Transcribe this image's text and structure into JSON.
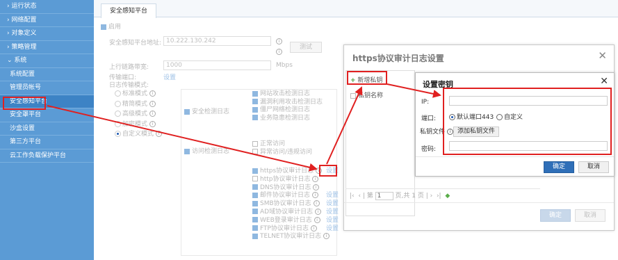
{
  "sidebar": {
    "items": [
      {
        "label": "› 运行状态"
      },
      {
        "label": "› 网络配置"
      },
      {
        "label": "› 对象定义"
      },
      {
        "label": "› 策略管理"
      },
      {
        "label": "⌄ 系统"
      },
      {
        "label": "系统配置"
      },
      {
        "label": "管理员帐号"
      },
      {
        "label": "安全感知平台"
      },
      {
        "label": "安全罩平台"
      },
      {
        "label": "沙盒设置"
      },
      {
        "label": "第三方平台"
      },
      {
        "label": "云工作负载保护平台"
      }
    ]
  },
  "tab": {
    "label": "安全感知平台"
  },
  "bg_form": {
    "enable_label": "启用",
    "address_label": "安全感知平台地址:",
    "address_value": "10.222.130.242",
    "test_button": "测试",
    "bandwidth_label": "上行链路带宽:",
    "bandwidth_value": "1000",
    "bandwidth_unit": "Mbps",
    "port_label": "传输端口:",
    "port_link": "设置",
    "mode_label": "日志传输模式:",
    "modes": [
      "标准模式",
      "精简模式",
      "高级模式",
      "加密模式",
      "自定义模式"
    ],
    "security_log": "安全检测日志",
    "access_log": "访问检测日志",
    "security_sub": [
      "网站攻击检测日志",
      "漏洞利用攻击检测日志",
      "僵尸网络检测日志",
      "业务隐患检测日志"
    ],
    "access_sub": [
      "正常访问",
      "异常访问/违规访问"
    ],
    "audit_list": [
      {
        "label": "https协议审计日志",
        "on": true,
        "link": "设置"
      },
      {
        "label": "http协议审计日志",
        "on": false,
        "link": ""
      },
      {
        "label": "DNS协议审计日志",
        "on": true,
        "link": ""
      },
      {
        "label": "邮件协议审计日志",
        "on": true,
        "link": "设置"
      },
      {
        "label": "SMB协议审计日志",
        "on": true,
        "link": "设置"
      },
      {
        "label": "AD域协议审计日志",
        "on": true,
        "link": "设置"
      },
      {
        "label": "WEB登录审计日志",
        "on": true,
        "link": "设置"
      },
      {
        "label": "FTP协议审计日志",
        "on": true,
        "link": "设置"
      },
      {
        "label": "TELNET协议审计日志",
        "on": true,
        "link": ""
      }
    ]
  },
  "dialog1": {
    "title": "https协议审计日志设置",
    "add_key": "新增私钥",
    "col_name": "私钥名称",
    "page_prefix": "第",
    "page_value": "1",
    "page_suffix": "页,共 1 页",
    "ok": "确定",
    "cancel": "取消"
  },
  "dialog2": {
    "title": "设置密钥",
    "ip_label": "IP:",
    "port_label": "端口:",
    "port_default": "默认端口443",
    "port_custom": "自定义",
    "keyfile_label": "私钥文件",
    "add_file": "添加私钥文件",
    "password_label": "密码:",
    "ok": "确定",
    "cancel": "取消"
  },
  "colors": {
    "sidebar": "#5b9bd5",
    "highlight": "#e02020",
    "primary": "#2f6fb8"
  }
}
